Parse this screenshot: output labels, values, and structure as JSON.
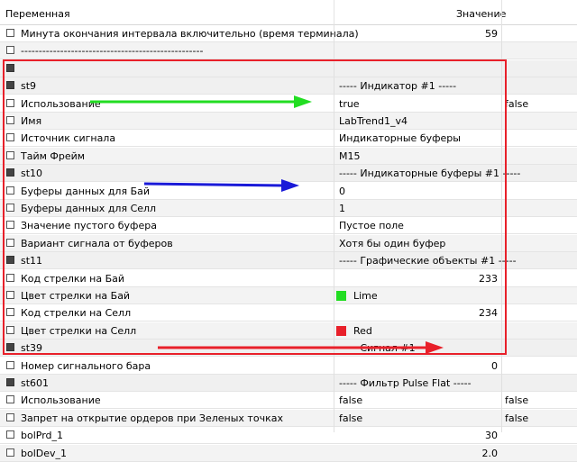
{
  "header": {
    "col_name": "Переменная",
    "col_value": "Значение"
  },
  "rows": [
    {
      "name": "Минута окончания интервала включительно (время терминала)",
      "value": "59",
      "numeric": true,
      "cb": "light",
      "style": "normal"
    },
    {
      "name": "---------------------------------------------------",
      "value": "",
      "cb": "light",
      "style": "alt"
    },
    {
      "name": "",
      "value": "",
      "cb": "dark",
      "style": "grp"
    },
    {
      "name": "st9",
      "value": "----- Индикатор #1 -----",
      "cb": "dark",
      "style": "grp"
    },
    {
      "name": "Использование",
      "value": "true",
      "alt": "false",
      "cb": "light",
      "style": "normal"
    },
    {
      "name": "Имя",
      "value": "LabTrend1_v4",
      "cb": "light",
      "style": "alt"
    },
    {
      "name": "Источник сигнала",
      "value": "Индикаторные буферы",
      "cb": "light",
      "style": "normal"
    },
    {
      "name": "Тайм Фрейм",
      "value": "M15",
      "cb": "light",
      "style": "alt"
    },
    {
      "name": "st10",
      "value": "----- Индикаторные буферы #1 -----",
      "cb": "dark",
      "style": "grp"
    },
    {
      "name": "Буферы данных для Бай",
      "value": "0",
      "cb": "light",
      "style": "normal"
    },
    {
      "name": "Буферы данных для Селл",
      "value": "1",
      "cb": "light",
      "style": "alt"
    },
    {
      "name": "Значение пустого буфера",
      "value": "Пустое поле",
      "cb": "light",
      "style": "normal"
    },
    {
      "name": "Вариант сигнала от буферов",
      "value": "Хотя бы один буфер",
      "cb": "light",
      "style": "alt"
    },
    {
      "name": "st11",
      "value": "----- Графические объекты #1 -----",
      "cb": "dark",
      "style": "grp"
    },
    {
      "name": "Код стрелки на Бай",
      "value": "233",
      "numeric": true,
      "cb": "light",
      "style": "normal"
    },
    {
      "name": "Цвет стрелки на Бай",
      "value": "Lime",
      "color": "#22dd22",
      "cb": "light",
      "style": "alt"
    },
    {
      "name": "Код стрелки на Селл",
      "value": "234",
      "numeric": true,
      "cb": "light",
      "style": "normal"
    },
    {
      "name": "Цвет стрелки на Селл",
      "value": "Red",
      "color": "#e8202a",
      "cb": "light",
      "style": "alt"
    },
    {
      "name": "st39",
      "value": "----- Сигнал #1 -----",
      "cb": "dark",
      "style": "grp"
    },
    {
      "name": "Номер сигнального бара",
      "value": "0",
      "numeric": true,
      "cb": "light",
      "style": "normal"
    },
    {
      "name": "st601",
      "value": "----- Фильтр Pulse Flat -----",
      "cb": "dark",
      "style": "grp"
    },
    {
      "name": "Использование",
      "value": "false",
      "alt": "false",
      "cb": "light",
      "style": "normal"
    },
    {
      "name": "Запрет на открытие ордеров при Зеленых точках",
      "value": "false",
      "alt": "false",
      "cb": "light",
      "style": "alt"
    },
    {
      "name": "bolPrd_1",
      "value": "30",
      "numeric": true,
      "cb": "light",
      "style": "normal"
    },
    {
      "name": "bolDev_1",
      "value": "2.0",
      "numeric": true,
      "cb": "light",
      "style": "alt"
    }
  ],
  "colors": {
    "arrow_green": "#22dd22",
    "arrow_blue": "#1a1ad8",
    "arrow_red": "#e8202a",
    "highlight": "#e8202a"
  }
}
